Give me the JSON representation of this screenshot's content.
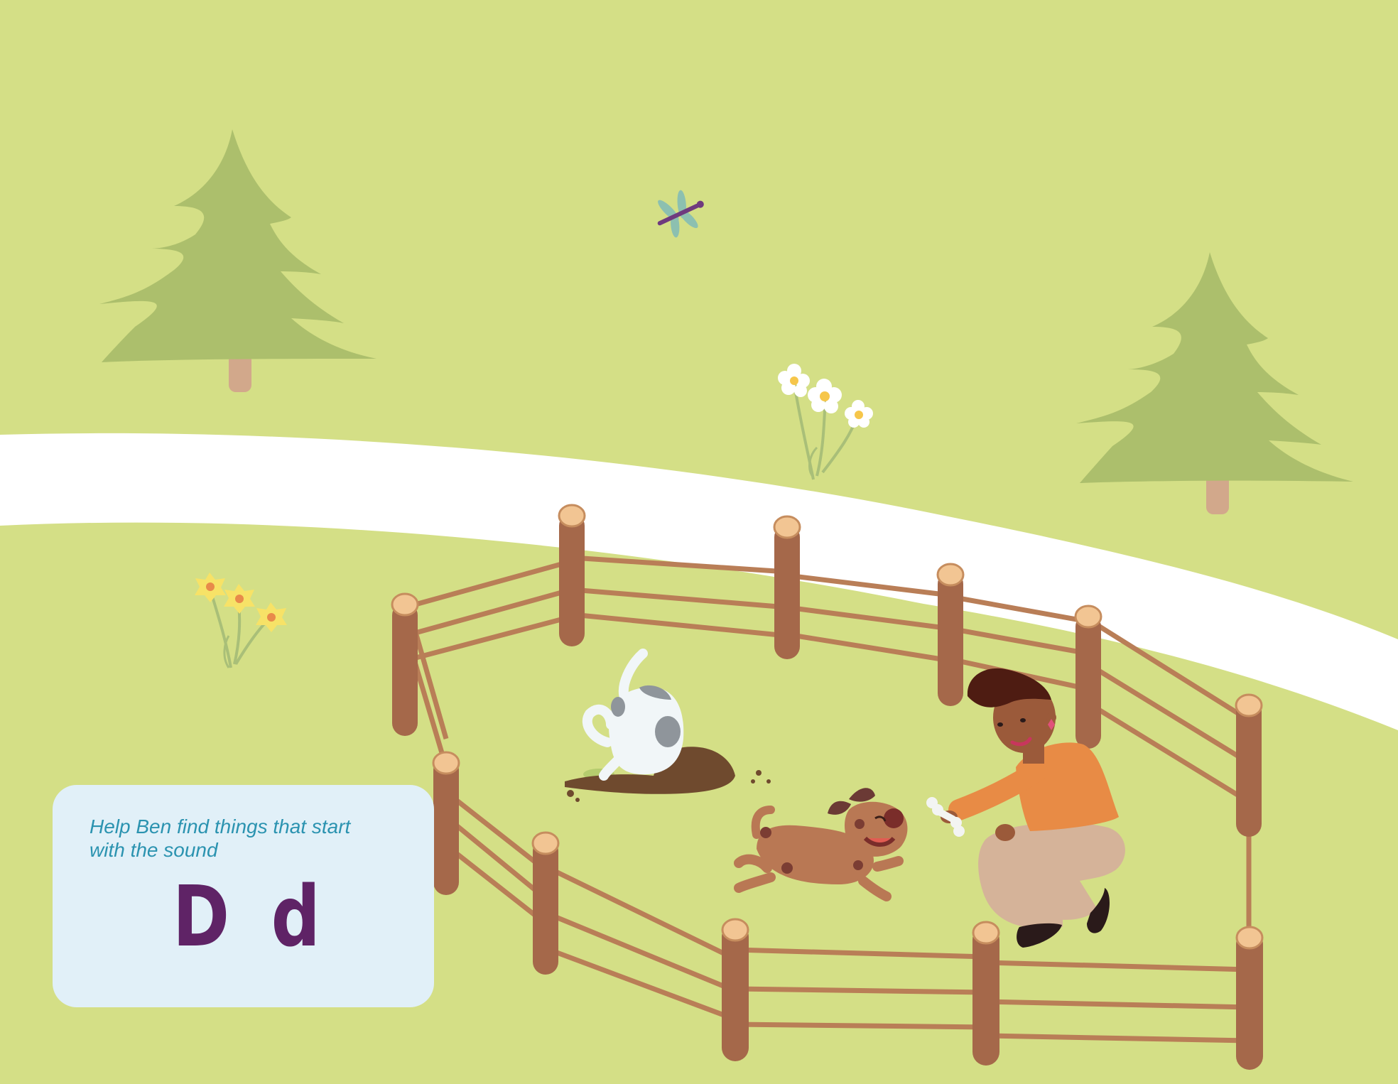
{
  "prompt": {
    "text_line1": "Help Ben find things that start",
    "text_line2": "with the sound",
    "letter_upper": "D",
    "letter_lower": "d"
  },
  "colors": {
    "grass": "#d4df86",
    "path": "#ffffff",
    "tree": "#acbf6c",
    "fence_post": "#a5684a",
    "fence_rail": "#b97e57",
    "card_bg": "#e1f0f8",
    "prompt_text": "#2b93b0",
    "letter": "#5f2366"
  },
  "scene_items": [
    "pine-tree",
    "pine-tree",
    "dragonfly",
    "white-daisies",
    "yellow-daffodils",
    "wooden-fence",
    "dog-digging",
    "dirt-mound",
    "brown-puppy",
    "woman-kneeling",
    "bone"
  ]
}
